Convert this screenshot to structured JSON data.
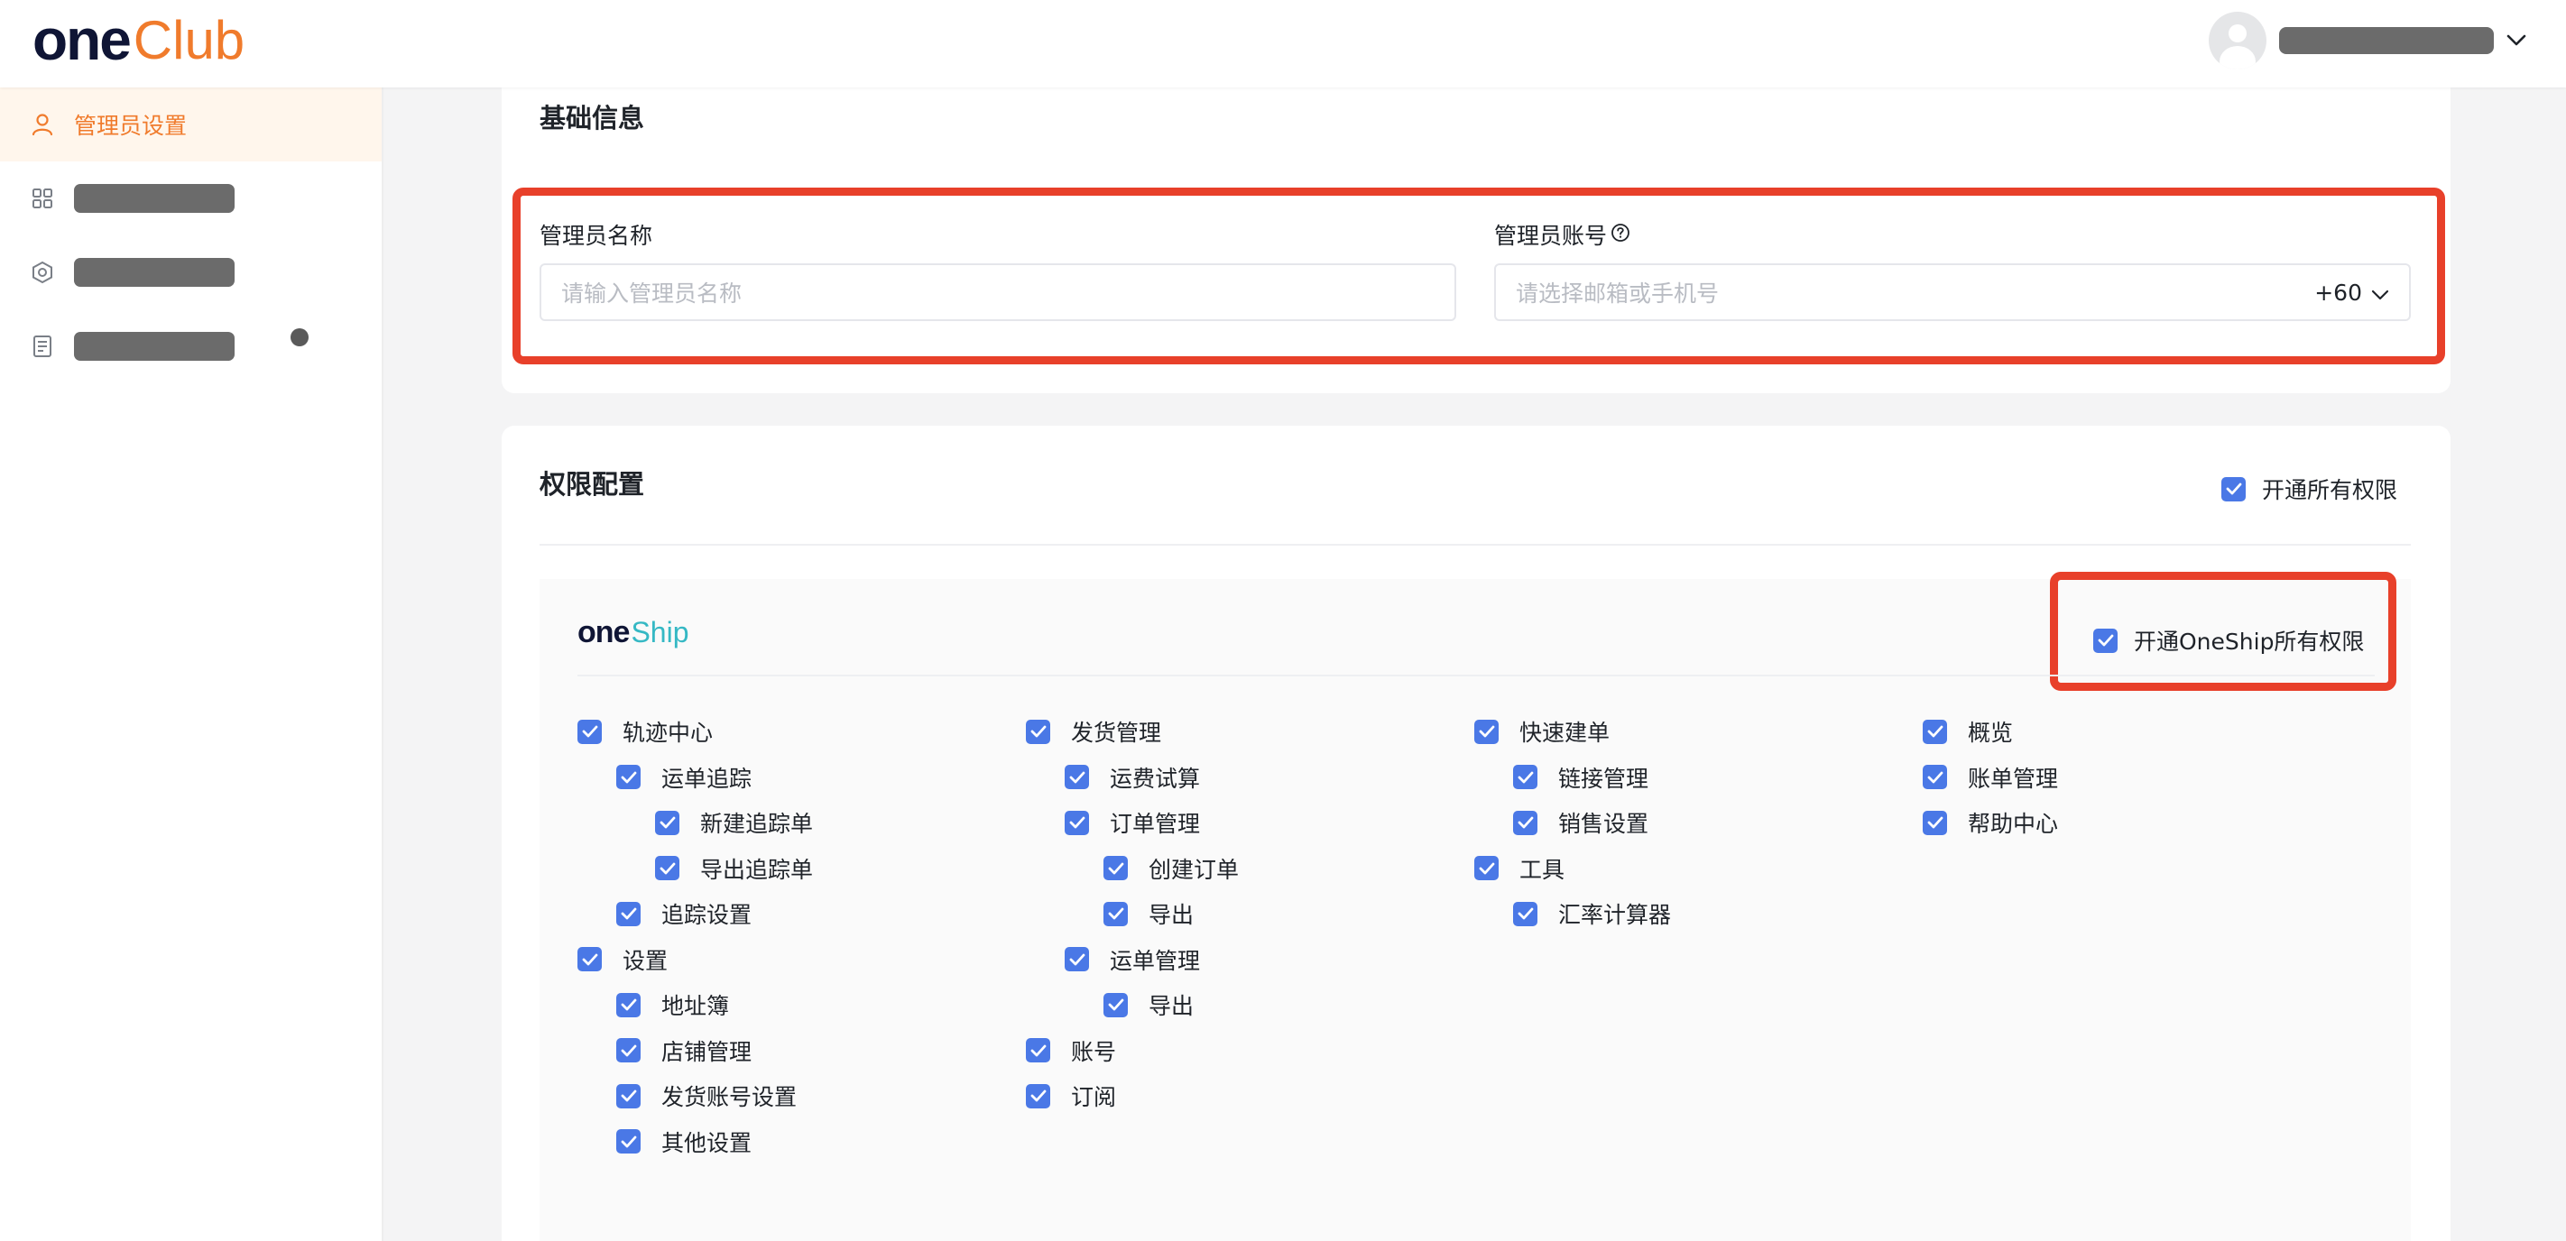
{
  "header": {
    "logo_one": "one",
    "logo_club": "Club"
  },
  "sidebar": {
    "items": [
      {
        "label": "管理员设置",
        "icon": "user-icon",
        "active": true
      },
      {
        "label": "",
        "icon": "grid-icon",
        "active": false
      },
      {
        "label": "",
        "icon": "settings-hex-icon",
        "active": false
      },
      {
        "label": "",
        "icon": "document-icon",
        "active": false
      }
    ]
  },
  "basic": {
    "title": "基础信息",
    "name_label": "管理员名称",
    "name_placeholder": "请输入管理员名称",
    "account_label": "管理员账号",
    "account_placeholder": "请选择邮箱或手机号",
    "phone_code": "+60"
  },
  "perm": {
    "title": "权限配置",
    "all_label": "开通所有权限",
    "oneship_logo_one": "one",
    "oneship_logo_ship": "Ship",
    "oneship_all_label": "开通OneShip所有权限",
    "columns": [
      [
        {
          "label": "轨迹中心",
          "level": 0
        },
        {
          "label": "运单追踪",
          "level": 1
        },
        {
          "label": "新建追踪单",
          "level": 2
        },
        {
          "label": "导出追踪单",
          "level": 2
        },
        {
          "label": "追踪设置",
          "level": 1
        },
        {
          "label": "设置",
          "level": 0
        },
        {
          "label": "地址簿",
          "level": 1
        },
        {
          "label": "店铺管理",
          "level": 1
        },
        {
          "label": "发货账号设置",
          "level": 1
        },
        {
          "label": "其他设置",
          "level": 1
        }
      ],
      [
        {
          "label": "发货管理",
          "level": 0
        },
        {
          "label": "运费试算",
          "level": 1
        },
        {
          "label": "订单管理",
          "level": 1
        },
        {
          "label": "创建订单",
          "level": 2
        },
        {
          "label": "导出",
          "level": 2
        },
        {
          "label": "运单管理",
          "level": 1
        },
        {
          "label": "导出",
          "level": 2
        },
        {
          "label": "账号",
          "level": 0
        },
        {
          "label": "订阅",
          "level": 0
        }
      ],
      [
        {
          "label": "快速建单",
          "level": 0
        },
        {
          "label": "链接管理",
          "level": 1
        },
        {
          "label": "销售设置",
          "level": 1
        },
        {
          "label": "工具",
          "level": 0
        },
        {
          "label": "汇率计算器",
          "level": 1
        }
      ],
      [
        {
          "label": "概览",
          "level": 0
        },
        {
          "label": "账单管理",
          "level": 0
        },
        {
          "label": "帮助中心",
          "level": 0
        }
      ]
    ]
  },
  "colors": {
    "brand_orange": "#f07b2c",
    "checkbox_blue": "#4a78e6",
    "highlight_red": "#e8402a",
    "oneship_teal": "#35b8c4"
  }
}
